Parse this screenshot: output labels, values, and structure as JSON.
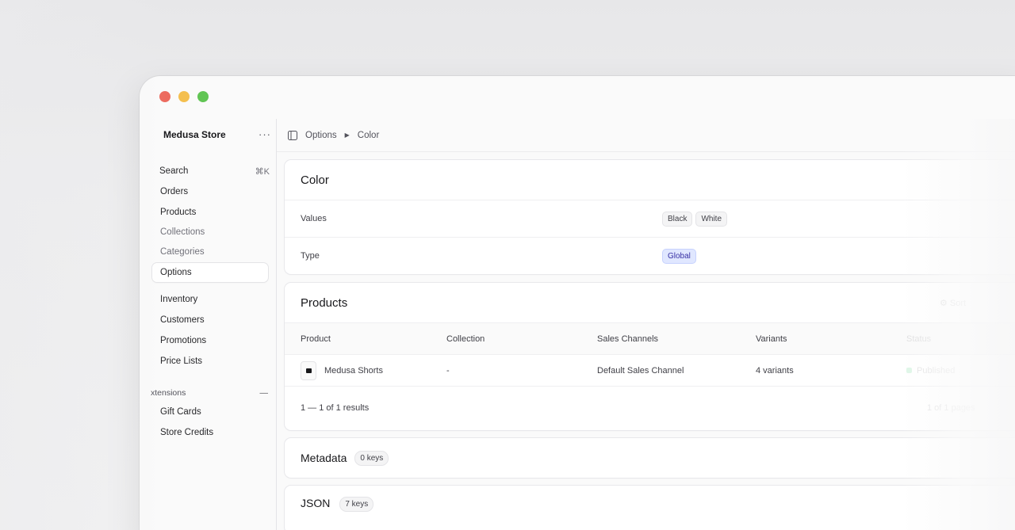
{
  "store": {
    "name": "Medusa Store",
    "menu_label": "···"
  },
  "nav": {
    "search": {
      "label": "Search",
      "shortcut": "⌘K"
    },
    "items": [
      {
        "label": "Orders"
      },
      {
        "label": "Products"
      },
      {
        "label": "Collections"
      },
      {
        "label": "Categories"
      },
      {
        "label": "Options"
      },
      {
        "label": "Inventory"
      },
      {
        "label": "Customers"
      },
      {
        "label": "Promotions"
      },
      {
        "label": "Price Lists"
      }
    ],
    "extensions": {
      "label": "xtensions",
      "collapse": "—",
      "items": [
        {
          "label": "Gift Cards"
        },
        {
          "label": "Store Credits"
        }
      ]
    }
  },
  "breadcrumb": {
    "parent": "Options",
    "current": "Color"
  },
  "option": {
    "title": "Color",
    "values_label": "Values",
    "values": [
      "Black",
      "White"
    ],
    "type_label": "Type",
    "type_value": "Global"
  },
  "products": {
    "title": "Products",
    "action": "Sort",
    "columns": [
      "Product",
      "Collection",
      "Sales Channels",
      "Variants",
      "Status"
    ],
    "rows": [
      {
        "product": "Medusa Shorts",
        "collection": "-",
        "sales_channels": "Default Sales Channel",
        "variants": "4 variants",
        "status": "Published"
      }
    ],
    "pagination": "1 — 1 of 1 results",
    "page_info": "1 of 1 pages"
  },
  "metadata": {
    "title": "Metadata",
    "badge": "0 keys"
  },
  "json": {
    "title": "JSON",
    "badge": "7 keys"
  },
  "colors": {
    "accent_blue": "#e0e7ff",
    "status_green": "#22c55e"
  }
}
